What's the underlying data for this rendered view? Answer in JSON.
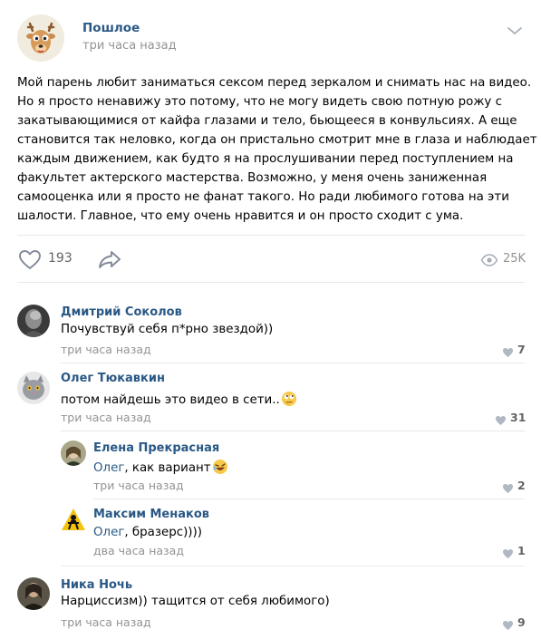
{
  "post": {
    "author": "Пошлое",
    "time": "три часа назад",
    "lines": [
      "Мой парень любит заниматься сексом перед зеркалом и снимать нас на видео.",
      "Но я просто ненавижу это потому, что не могу видеть свою потную рожу с",
      "закатывающимися от кайфа глазами и тело, бьющееся в конвульсиях. А еще",
      "становится так неловко, когда он пристально смотрит мне в глаза и наблюдает за",
      "каждым движением, как будто я на прослушивании перед поступлением на",
      "факультет актерского мастерства. Возможно, у меня очень заниженная",
      "самооценка или я просто не фанат такого. Но ради любимого готова на эти",
      "шалости. Главное, что ему очень нравится и он просто сходит с ума."
    ],
    "likes": "193",
    "views": "25K"
  },
  "comments": [
    {
      "name": "Дмитрий Соколов",
      "text": "Почувствуй себя п*рно звездой))",
      "time": "три часа назад",
      "likes": "7"
    },
    {
      "name": "Олег Тюкавкин",
      "text": "потом найдешь это видео в сети..",
      "emoji": "rolling-eyes",
      "time": "три часа назад",
      "likes": "31"
    },
    {
      "name": "Елена Прекрасная",
      "reply_to": "Олег",
      "text": ", как вариант",
      "emoji": "rofl",
      "time": "три часа назад",
      "likes": "2"
    },
    {
      "name": "Максим Менаков",
      "reply_to": "Олег",
      "text": ", бразерс))))",
      "time": "два часа назад",
      "likes": "1"
    },
    {
      "name": "Ника Ночь",
      "text": "Нарциссизм)) тащится от себя любимого)",
      "time": "три часа назад",
      "likes": "9"
    }
  ],
  "colors": {
    "link": "#2a5885",
    "meta": "#939393",
    "divider": "#e7e8ec"
  }
}
